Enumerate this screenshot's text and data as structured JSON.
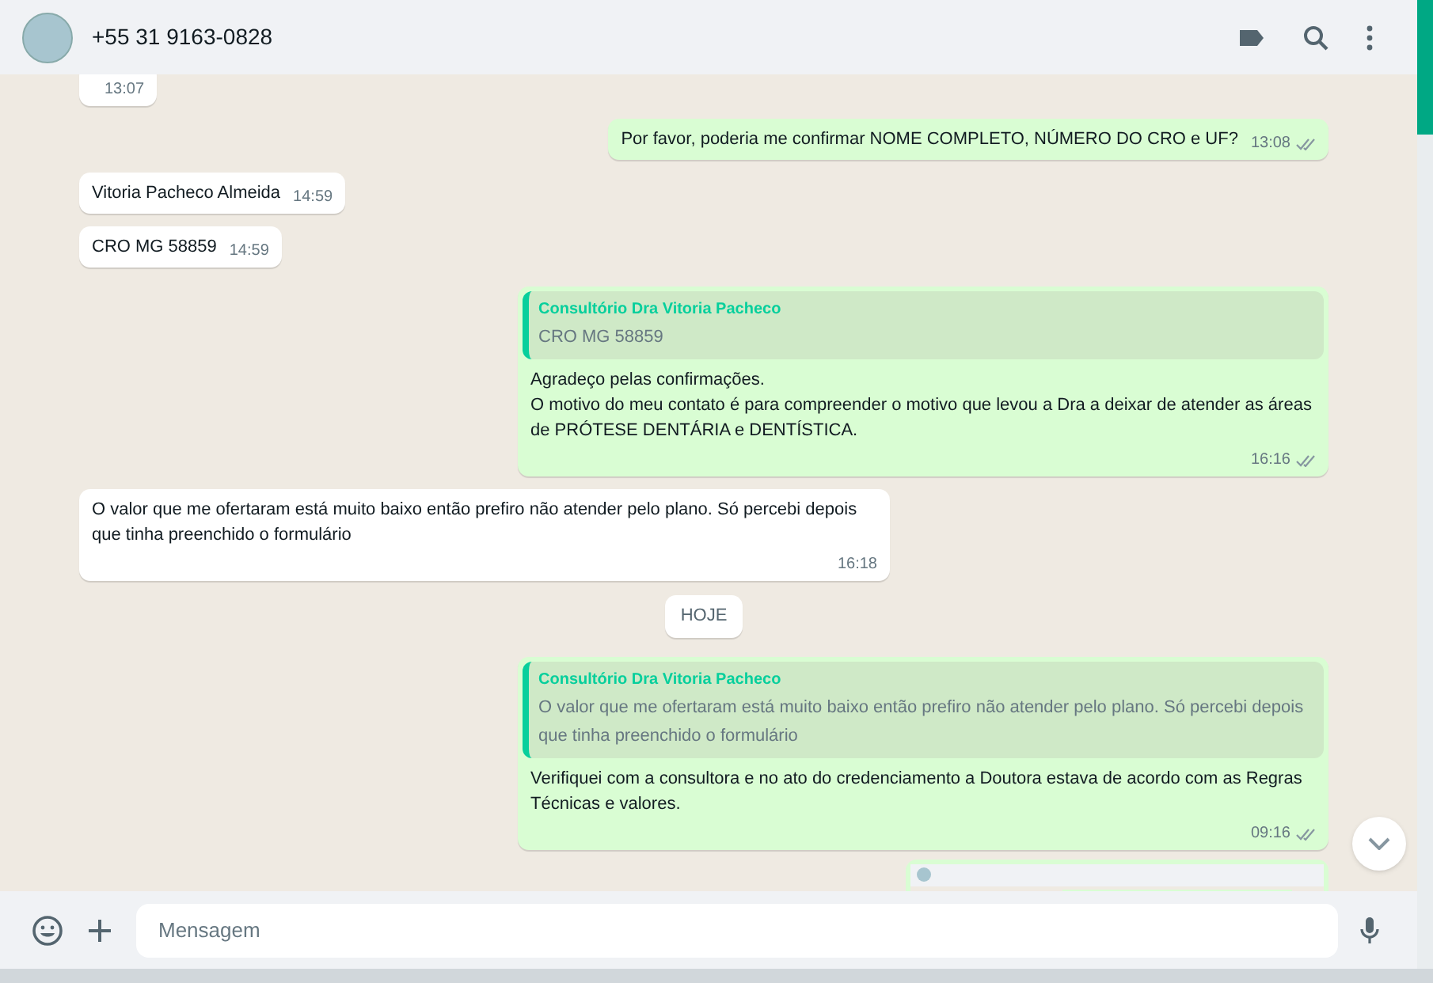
{
  "header": {
    "contact": "+55 31 9163-0828"
  },
  "messages": [
    {
      "kind": "in",
      "time": "13:07"
    },
    {
      "kind": "out",
      "text": "Por favor, poderia me confirmar NOME COMPLETO, NÚMERO DO CRO e UF?",
      "time": "13:08",
      "read": false
    },
    {
      "kind": "in",
      "text": "Vitoria Pacheco Almeida",
      "time": "14:59"
    },
    {
      "kind": "in",
      "text": "CRO MG 58859",
      "time": "14:59"
    },
    {
      "kind": "out",
      "quote": {
        "author": "Consultório Dra Vitoria Pacheco",
        "text": "CRO MG 58859"
      },
      "text": "Agradeço pelas confirmações.\nO motivo do meu contato é para compreender o motivo que levou a Dra a deixar de atender as áreas de  PRÓTESE DENTÁRIA e DENTÍSTICA.",
      "time": "16:16",
      "read": false
    },
    {
      "kind": "in",
      "text": "O valor que me ofertaram está muito baixo então prefiro não atender pelo plano. Só percebi depois que tinha preenchido o formulário",
      "time": "16:18"
    },
    {
      "kind": "date",
      "text": "HOJE"
    },
    {
      "kind": "out",
      "quote": {
        "author": "Consultório Dra Vitoria Pacheco",
        "text": "O valor que me ofertaram está muito baixo então prefiro não atender pelo plano. Só percebi depois que tinha preenchido o formulário"
      },
      "text": "Verifiquei com a consultora e no ato do credenciamento a Doutora estava de acordo com as Regras Técnicas e valores.",
      "time": "09:16",
      "read": false
    },
    {
      "kind": "image"
    }
  ],
  "composer": {
    "placeholder": "Mensagem"
  }
}
